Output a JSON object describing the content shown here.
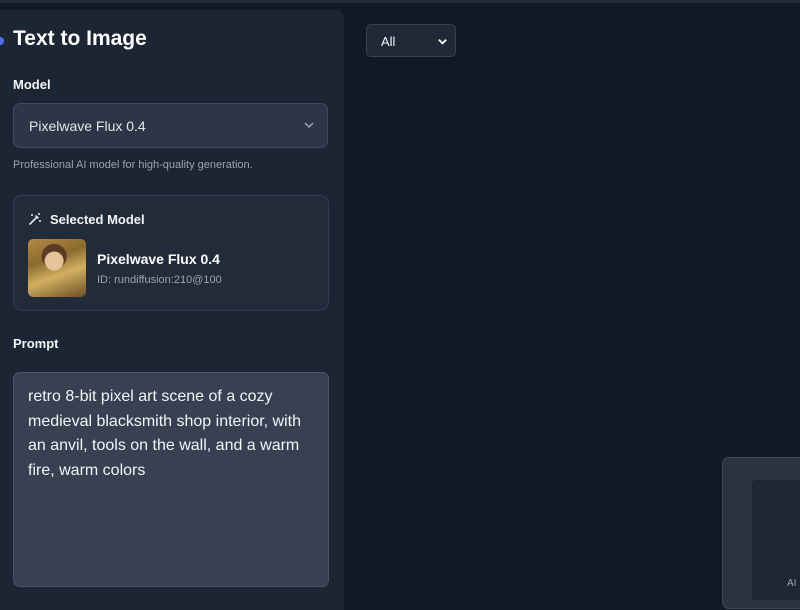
{
  "panel": {
    "title": "Text to Image",
    "model_label": "Model",
    "model_selected": "Pixelwave Flux 0.4",
    "model_hint": "Professional AI model for high-quality generation.",
    "selected_card": {
      "heading": "Selected Model",
      "name": "Pixelwave Flux 0.4",
      "id": "ID: rundiffusion:210@100"
    },
    "prompt_label": "Prompt",
    "prompt_value": "retro 8-bit pixel art scene of a cozy medieval blacksmith shop interior, with an anvil, tools on the wall, and a warm fire, warm colors"
  },
  "main": {
    "filter_selected": "All"
  },
  "preview_widget": {
    "badge": "AI"
  },
  "colors": {
    "accent": "#4f6ee8",
    "dot_red": "#ef4444",
    "dot_yellow": "#eab308",
    "dot_green": "#22c55e"
  },
  "icons": [
    "chevron-down-icon",
    "magic-wand-icon"
  ]
}
